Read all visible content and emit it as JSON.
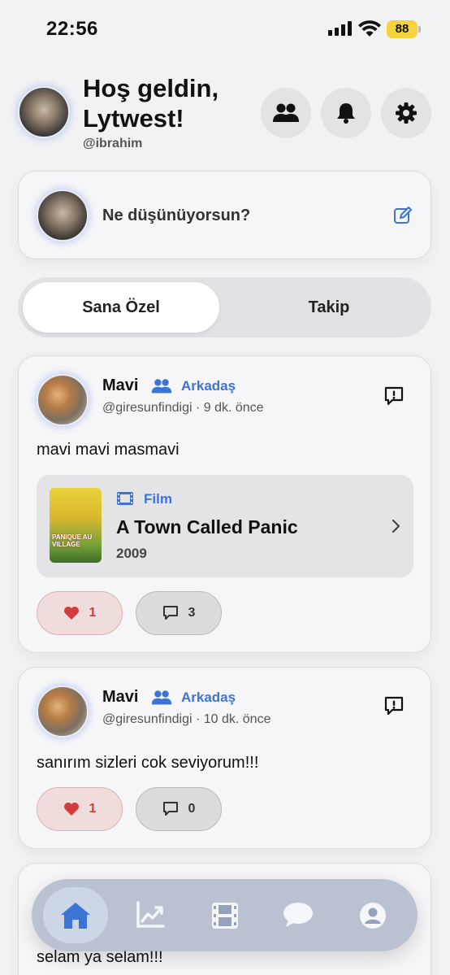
{
  "status_bar": {
    "time": "22:56",
    "battery": "88"
  },
  "header": {
    "greeting": "Hoş geldin, Lytwest!",
    "handle": "@ibrahim",
    "icons": [
      "friends-icon",
      "bell-icon",
      "gear-icon"
    ]
  },
  "composer": {
    "placeholder": "Ne düşünüyorsun?",
    "icon": "edit-icon"
  },
  "tabs": [
    {
      "label": "Sana Özel",
      "active": true
    },
    {
      "label": "Takip",
      "active": false
    }
  ],
  "posts": [
    {
      "name": "Mavi",
      "relation": "Arkadaş",
      "meta": "@giresunfindigi · 9 dk. önce",
      "text": "mavi mavi masmavi",
      "media": {
        "type_label": "Film",
        "title": "A Town Called Panic",
        "year": "2009",
        "poster_text": "PANIQUE AU VILLAGE"
      },
      "likes": "1",
      "comments": "3"
    },
    {
      "name": "Mavi",
      "relation": "Arkadaş",
      "meta": "@giresunfindigi · 10 dk. önce",
      "text": "sanırım sizleri cok seviyorum!!!",
      "likes": "1",
      "comments": "0"
    },
    {
      "text": "selam ya selam!!!"
    }
  ],
  "tabbar": {
    "items": [
      "home-icon",
      "chart-icon",
      "film-icon",
      "chat-icon",
      "profile-icon"
    ],
    "active": "home-icon"
  },
  "colors": {
    "accent": "#3b74d4",
    "like": "#d23b3b",
    "background": "#f2f2f4"
  }
}
